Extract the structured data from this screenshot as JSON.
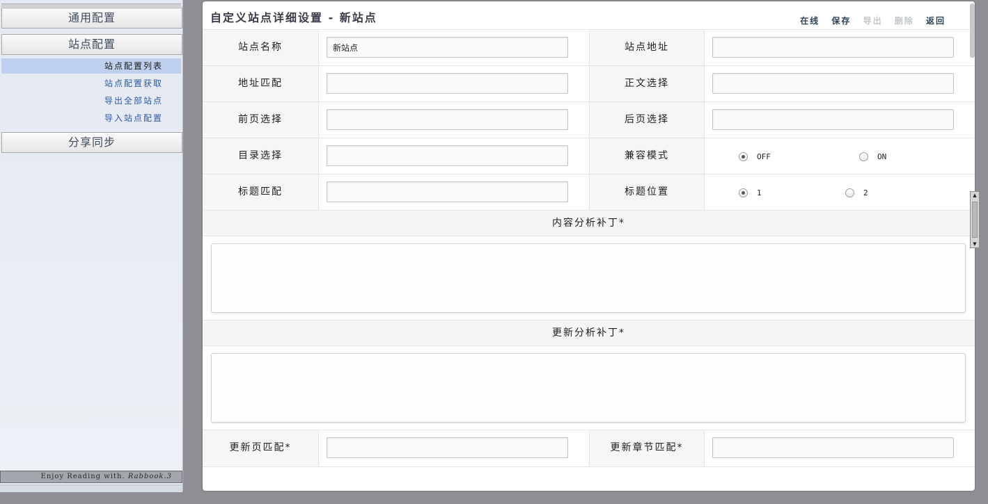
{
  "sidebar": {
    "categories": [
      "通用配置",
      "站点配置",
      "分享同步"
    ],
    "sub_items": [
      "站点配置列表",
      "站点配置获取",
      "导出全部站点",
      "导入站点配置"
    ],
    "footer_text": "Enjoy Reading with.",
    "footer_brand": "Rabbook.3"
  },
  "panel": {
    "title": "自定义站点详细设置 - 新站点",
    "actions": [
      {
        "label": "在线",
        "enabled": true
      },
      {
        "label": "保存",
        "enabled": true
      },
      {
        "label": "导出",
        "enabled": false
      },
      {
        "label": "删除",
        "enabled": false
      },
      {
        "label": "返回",
        "enabled": true
      }
    ]
  },
  "form": {
    "site_name": {
      "label": "站点名称",
      "value": "新站点"
    },
    "site_url": {
      "label": "站点地址",
      "value": ""
    },
    "url_match": {
      "label": "地址匹配",
      "value": ""
    },
    "body_select": {
      "label": "正文选择",
      "value": ""
    },
    "prev_select": {
      "label": "前页选择",
      "value": ""
    },
    "next_select": {
      "label": "后页选择",
      "value": ""
    },
    "toc_select": {
      "label": "目录选择",
      "value": ""
    },
    "compat_mode": {
      "label": "兼容模式",
      "options": [
        "OFF",
        "ON"
      ],
      "selected": "OFF"
    },
    "title_match": {
      "label": "标题匹配",
      "value": ""
    },
    "title_pos": {
      "label": "标题位置",
      "options": [
        "1",
        "2"
      ],
      "selected": "1"
    },
    "content_patch": {
      "label": "内容分析补丁*",
      "value": ""
    },
    "update_patch": {
      "label": "更新分析补丁*",
      "value": ""
    },
    "update_page_match": {
      "label": "更新页匹配*",
      "value": ""
    },
    "update_chapter_match": {
      "label": "更新章节匹配*",
      "value": ""
    }
  },
  "colors": {
    "background": "#8e8e94",
    "sidebar_active": "#bfd0ee",
    "link": "#2a5aa8",
    "action": "#2f4458",
    "action_disabled": "#c3c7cc"
  }
}
